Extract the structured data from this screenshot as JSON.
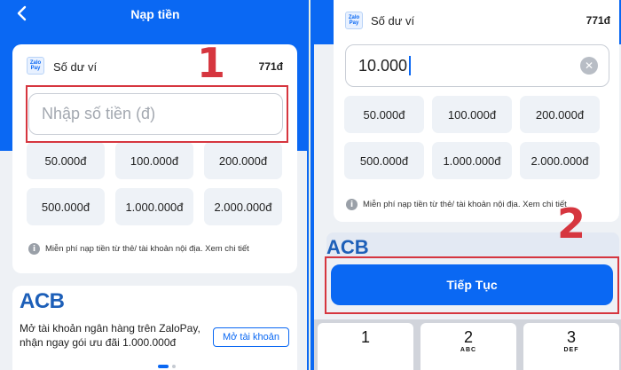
{
  "colors": {
    "primary": "#0a68f3",
    "highlight": "#d6363f",
    "chip_bg": "#eef2f7"
  },
  "left": {
    "header": {
      "title": "Nạp tiền",
      "back_icon": "chevron-left-icon"
    },
    "wallet": {
      "logo_text": "Zalo Pay",
      "label": "Số dư ví",
      "balance": "771đ"
    },
    "amount_input": {
      "placeholder": "Nhập số tiền (đ)",
      "value": ""
    },
    "step_marker": "1",
    "quick_amounts": [
      "50.000đ",
      "100.000đ",
      "200.000đ",
      "500.000đ",
      "1.000.000đ",
      "2.000.000đ"
    ],
    "info": {
      "icon": "info-icon",
      "text": "Miễn phí nạp tiền từ thẻ/ tài khoản nội địa. Xem chi tiết"
    },
    "promo": {
      "logo": "ACB",
      "line1": "Mở tài khoản ngân hàng trên ZaloPay,",
      "line2": "nhận ngay gói ưu đãi 1.000.000đ",
      "button_label": "Mở tài khoản"
    }
  },
  "right": {
    "wallet": {
      "logo_text": "Zalo Pay",
      "label": "Số dư ví",
      "balance": "771đ"
    },
    "amount_input": {
      "value": "10.000",
      "clear_icon": "clear-icon"
    },
    "quick_amounts": [
      "50.000đ",
      "100.000đ",
      "200.000đ",
      "500.000đ",
      "1.000.000đ",
      "2.000.000đ"
    ],
    "info": {
      "icon": "info-icon",
      "text": "Miễn phí nạp tiền từ thẻ/ tài khoản nội địa. Xem chi tiết"
    },
    "promo_peek": "ACB",
    "step_marker": "2",
    "continue_label": "Tiếp Tục",
    "keypad": [
      {
        "num": "1",
        "letters": ""
      },
      {
        "num": "2",
        "letters": "ABC"
      },
      {
        "num": "3",
        "letters": "DEF"
      }
    ]
  }
}
